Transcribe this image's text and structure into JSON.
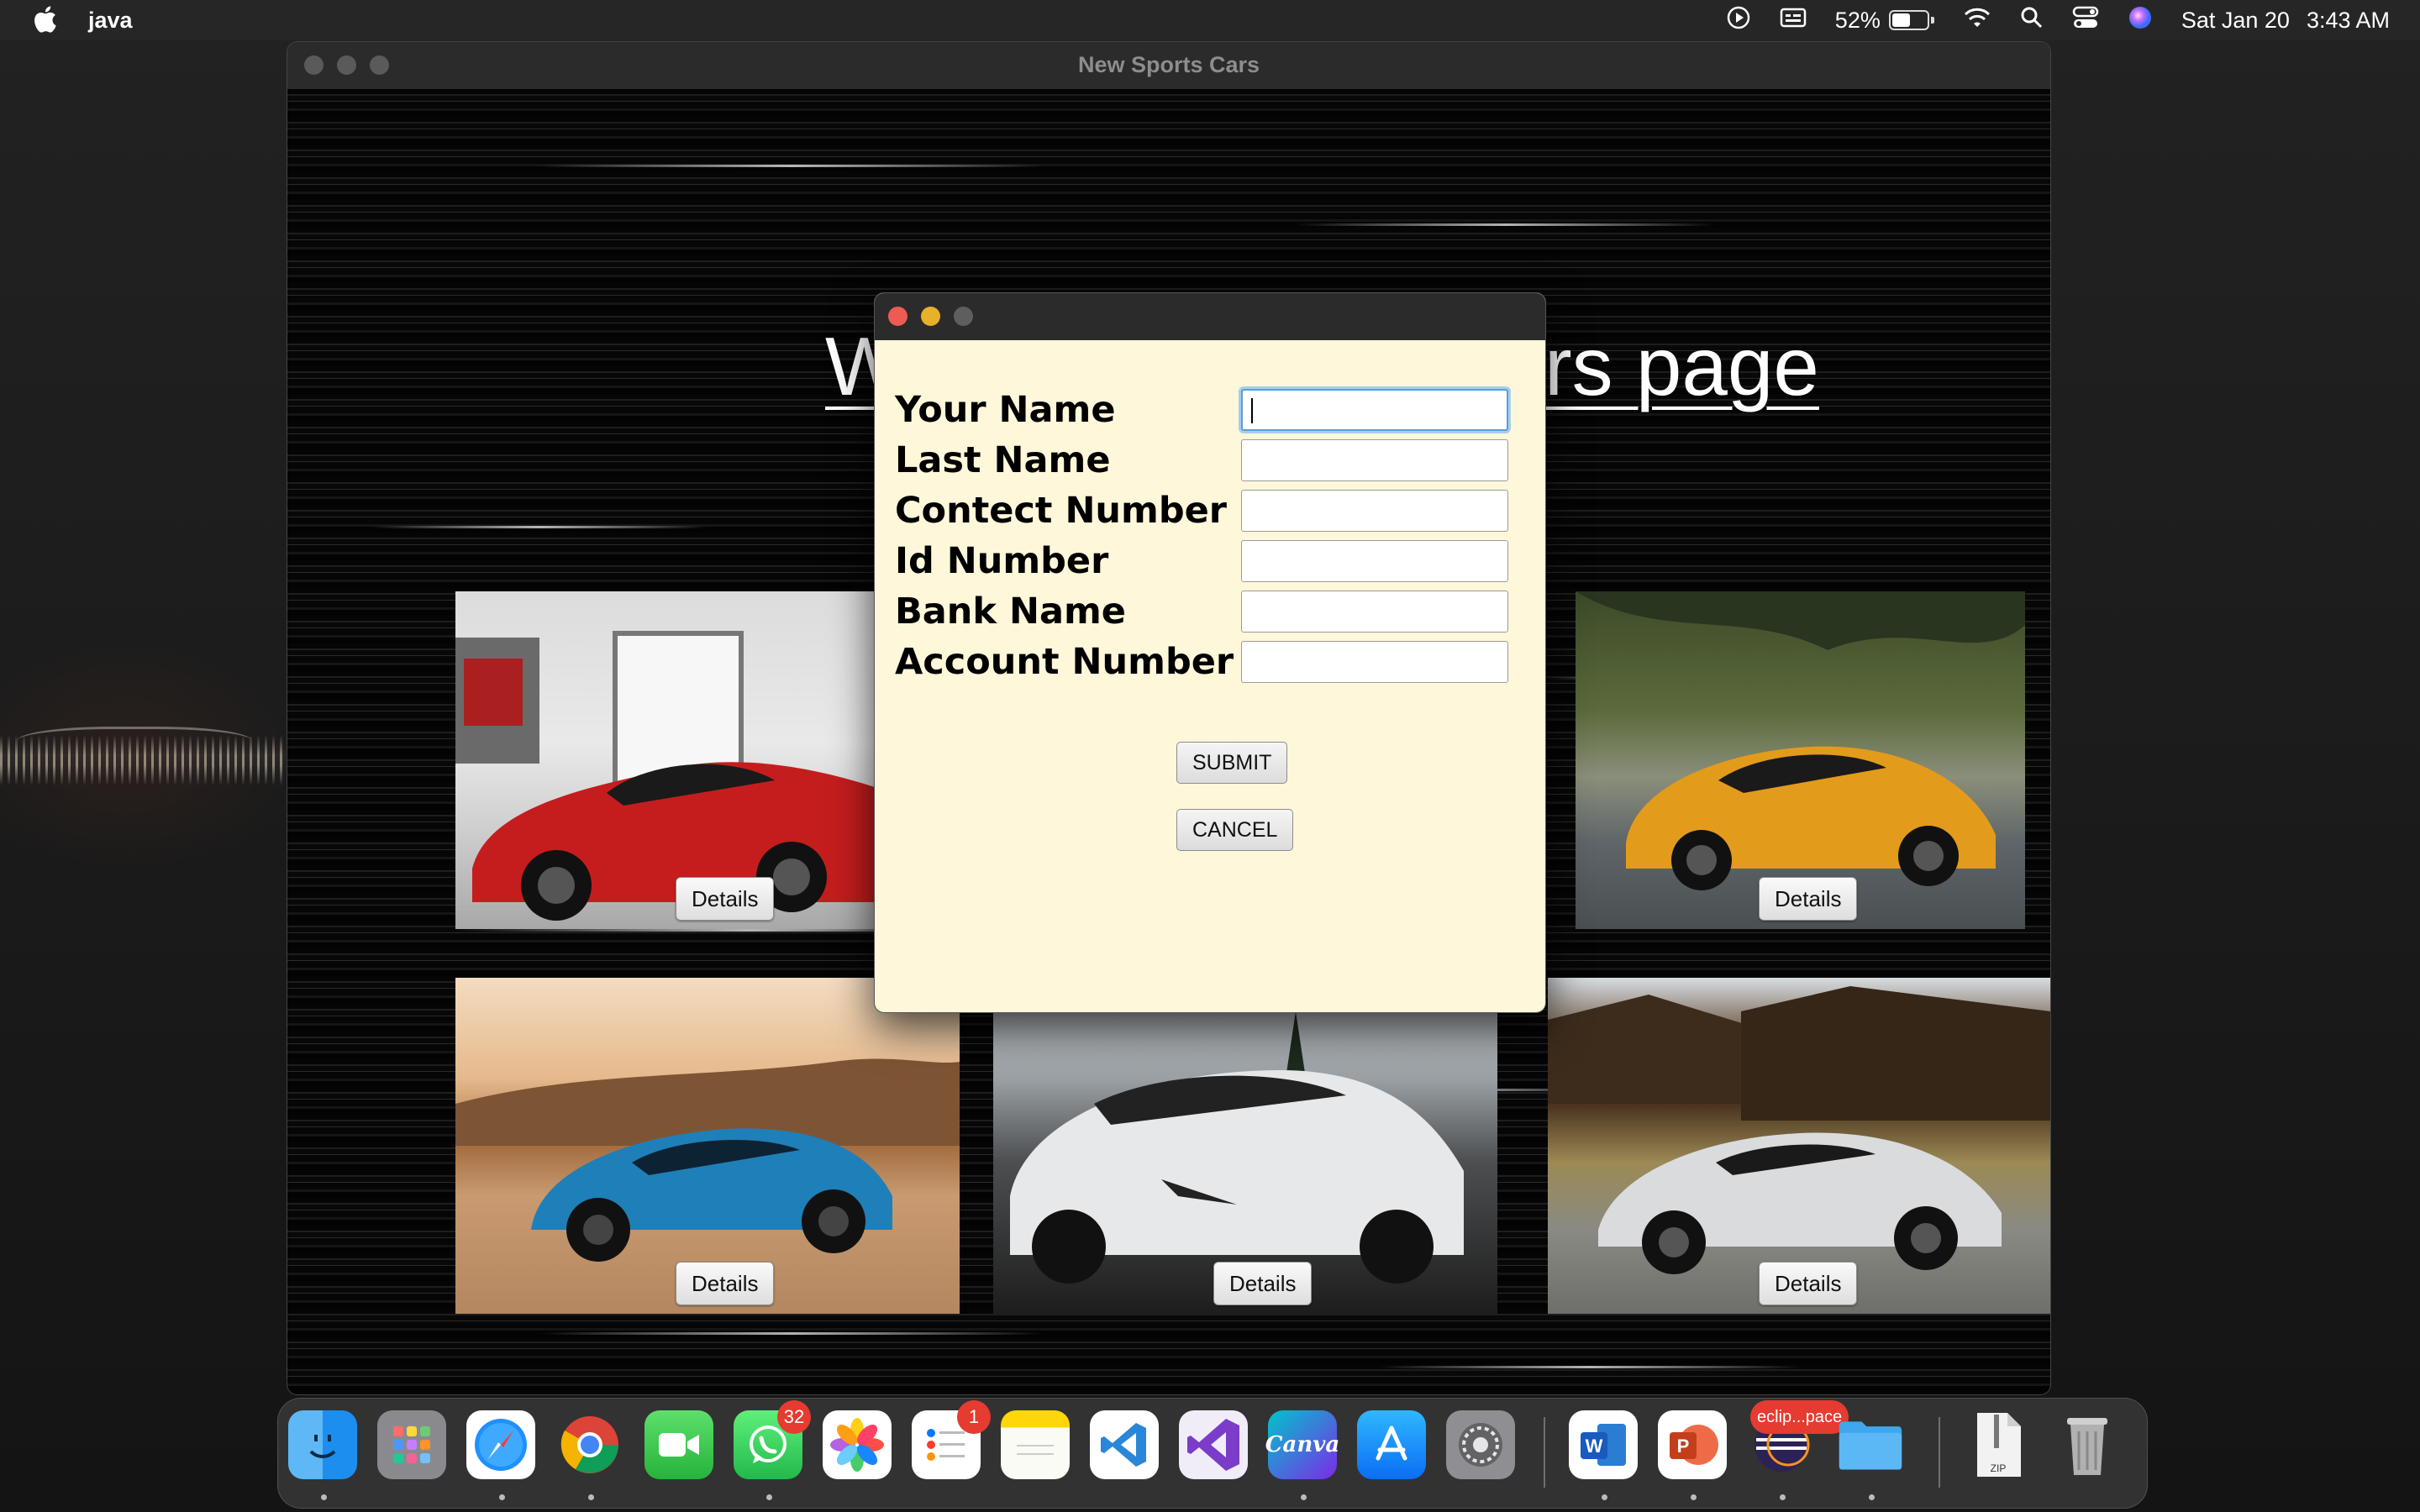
{
  "menubar": {
    "app_name": "java",
    "battery_percent": "52%",
    "battery_level": 0.52,
    "date": "Sat Jan 20",
    "time": "3:43 AM",
    "icons": [
      "apple-logo-icon",
      "play-circle-icon",
      "keyboard-brightness-icon",
      "battery-icon",
      "wifi-icon",
      "search-icon",
      "control-center-icon",
      "siri-icon"
    ]
  },
  "window": {
    "title": "New Sports Cars",
    "heading_left": "W",
    "heading_right": "cars page"
  },
  "cars": [
    {
      "name": "red-supercar",
      "button": "Details"
    },
    {
      "name": "orange-supercar",
      "button": "Details"
    },
    {
      "name": "blue-muscle-car",
      "button": "Details"
    },
    {
      "name": "white-lamborghini",
      "button": "Details"
    },
    {
      "name": "silver-mclaren",
      "button": "Details"
    }
  ],
  "dialog": {
    "fields": [
      {
        "label": "Your Name",
        "value": ""
      },
      {
        "label": "Last Name",
        "value": ""
      },
      {
        "label": "Contect Number",
        "value": ""
      },
      {
        "label": "Id Number",
        "value": ""
      },
      {
        "label": "Bank Name",
        "value": ""
      },
      {
        "label": "Account Number",
        "value": ""
      }
    ],
    "submit_label": "SUBMIT",
    "cancel_label": "CANCEL"
  },
  "dock": {
    "whatsapp_badge": "32",
    "reminders_badge": "1",
    "eclipse_label": "eclip...pace",
    "canva_label": "Canva",
    "zip_label": "ZIP"
  },
  "colors": {
    "dialog_bg": "#fff7da",
    "focus_ring": "#5a9fd4",
    "badge_red": "#e53b30"
  }
}
